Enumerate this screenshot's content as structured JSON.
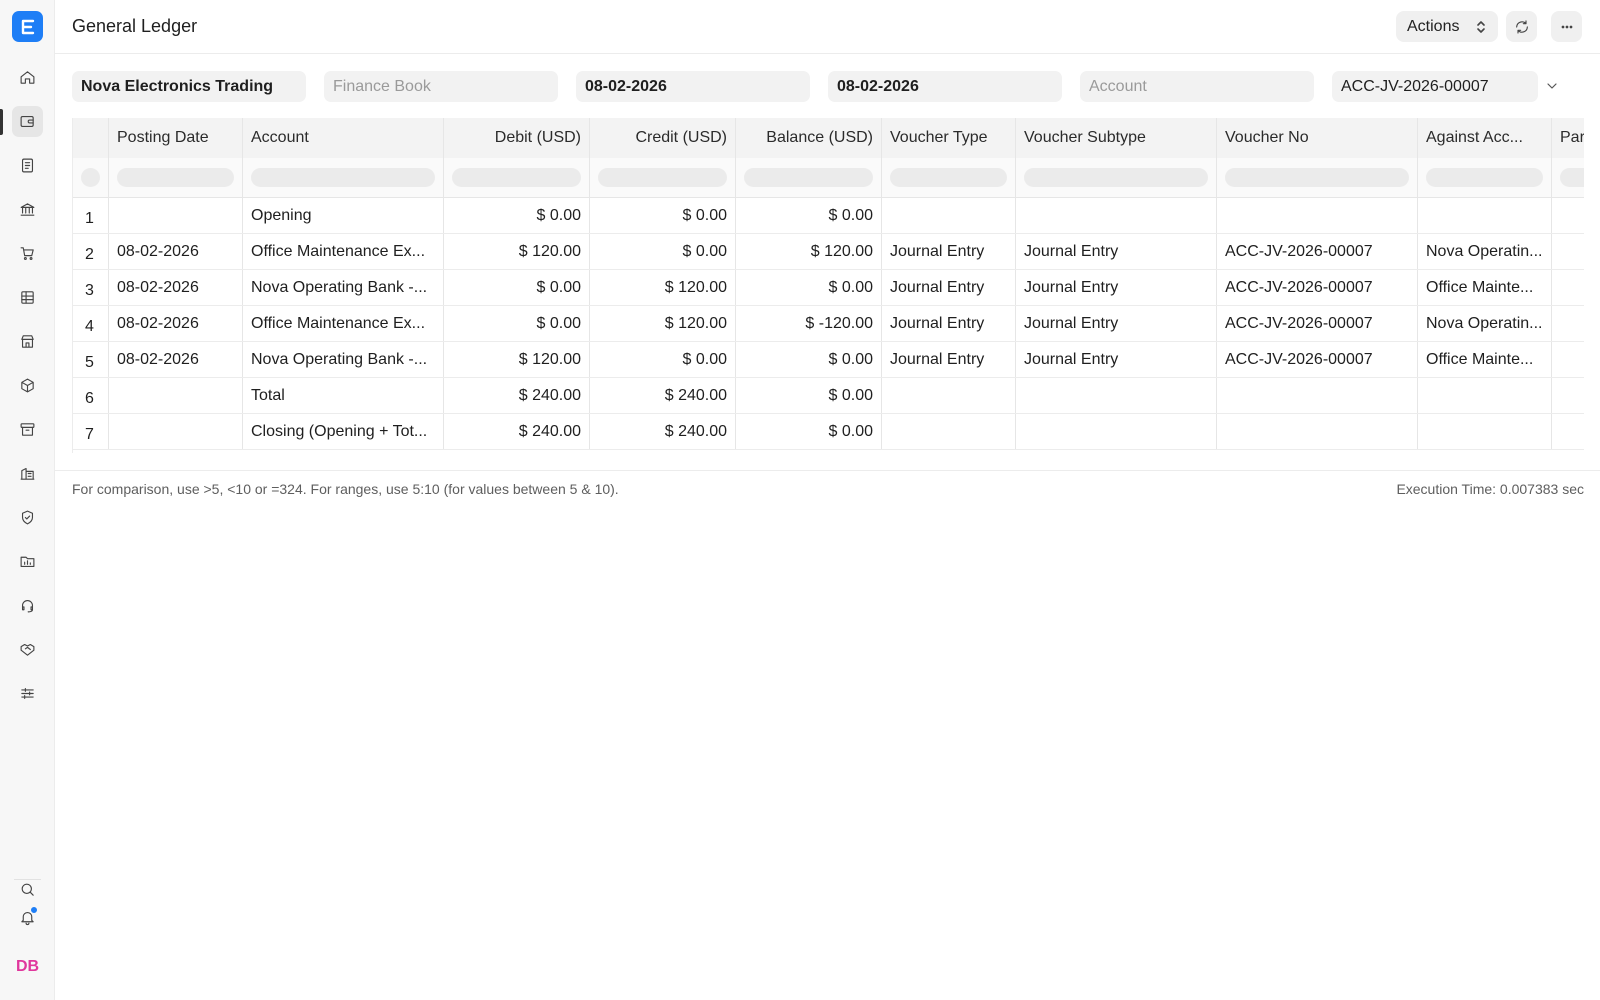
{
  "app": {
    "logo_letter": "E",
    "accent": "#1e7ef6"
  },
  "sidebar": {
    "items": [
      {
        "name": "home-icon"
      },
      {
        "name": "wallet-icon",
        "active": true
      },
      {
        "name": "document-icon"
      },
      {
        "name": "bank-icon"
      },
      {
        "name": "cart-icon"
      },
      {
        "name": "table-icon"
      },
      {
        "name": "store-icon"
      },
      {
        "name": "package-icon"
      },
      {
        "name": "archive-icon"
      },
      {
        "name": "building-icon"
      },
      {
        "name": "shield-icon"
      },
      {
        "name": "folder-chart-icon"
      },
      {
        "name": "headset-icon"
      },
      {
        "name": "handshake-icon"
      },
      {
        "name": "sliders-icon"
      }
    ],
    "footer": {
      "search_icon": "search-icon",
      "bell_icon": "bell-icon",
      "avatar_initials": "DB",
      "avatar_color": "#e0379d"
    }
  },
  "header": {
    "title": "General Ledger",
    "actions_label": "Actions"
  },
  "filters": {
    "company": "Nova Electronics Trading",
    "finance_book_placeholder": "Finance Book",
    "from_date": "08-02-2026",
    "to_date": "08-02-2026",
    "account_placeholder": "Account",
    "voucher_no": "ACC-JV-2026-00007"
  },
  "table": {
    "columns": [
      "Posting Date",
      "Account",
      "Debit (USD)",
      "Credit (USD)",
      "Balance (USD)",
      "Voucher Type",
      "Voucher Subtype",
      "Voucher No",
      "Against Acc...",
      "Par"
    ],
    "rows": [
      {
        "idx": "1",
        "posting_date": "",
        "account": "Opening",
        "debit": "$ 0.00",
        "credit": "$ 0.00",
        "balance": "$ 0.00",
        "voucher_type": "",
        "voucher_subtype": "",
        "voucher_no": "",
        "against": ""
      },
      {
        "idx": "2",
        "posting_date": "08-02-2026",
        "account": "Office Maintenance Ex...",
        "debit": "$ 120.00",
        "credit": "$ 0.00",
        "balance": "$ 120.00",
        "voucher_type": "Journal Entry",
        "voucher_subtype": "Journal Entry",
        "voucher_no": "ACC-JV-2026-00007",
        "against": "Nova Operatin..."
      },
      {
        "idx": "3",
        "posting_date": "08-02-2026",
        "account": "Nova Operating Bank -...",
        "debit": "$ 0.00",
        "credit": "$ 120.00",
        "balance": "$ 0.00",
        "voucher_type": "Journal Entry",
        "voucher_subtype": "Journal Entry",
        "voucher_no": "ACC-JV-2026-00007",
        "against": "Office Mainte..."
      },
      {
        "idx": "4",
        "posting_date": "08-02-2026",
        "account": "Office Maintenance Ex...",
        "debit": "$ 0.00",
        "credit": "$ 120.00",
        "balance": "$ -120.00",
        "voucher_type": "Journal Entry",
        "voucher_subtype": "Journal Entry",
        "voucher_no": "ACC-JV-2026-00007",
        "against": "Nova Operatin..."
      },
      {
        "idx": "5",
        "posting_date": "08-02-2026",
        "account": "Nova Operating Bank -...",
        "debit": "$ 120.00",
        "credit": "$ 0.00",
        "balance": "$ 0.00",
        "voucher_type": "Journal Entry",
        "voucher_subtype": "Journal Entry",
        "voucher_no": "ACC-JV-2026-00007",
        "against": "Office Mainte..."
      },
      {
        "idx": "6",
        "posting_date": "",
        "account": "Total",
        "debit": "$ 240.00",
        "credit": "$ 240.00",
        "balance": "$ 0.00",
        "voucher_type": "",
        "voucher_subtype": "",
        "voucher_no": "",
        "against": ""
      },
      {
        "idx": "7",
        "posting_date": "",
        "account": "Closing (Opening + Tot...",
        "debit": "$ 240.00",
        "credit": "$ 240.00",
        "balance": "$ 0.00",
        "voucher_type": "",
        "voucher_subtype": "",
        "voucher_no": "",
        "against": ""
      }
    ]
  },
  "footer": {
    "help": "For comparison, use >5, <10 or =324. For ranges, use 5:10 (for values between 5 & 10).",
    "execution_time": "Execution Time: 0.007383 sec"
  }
}
